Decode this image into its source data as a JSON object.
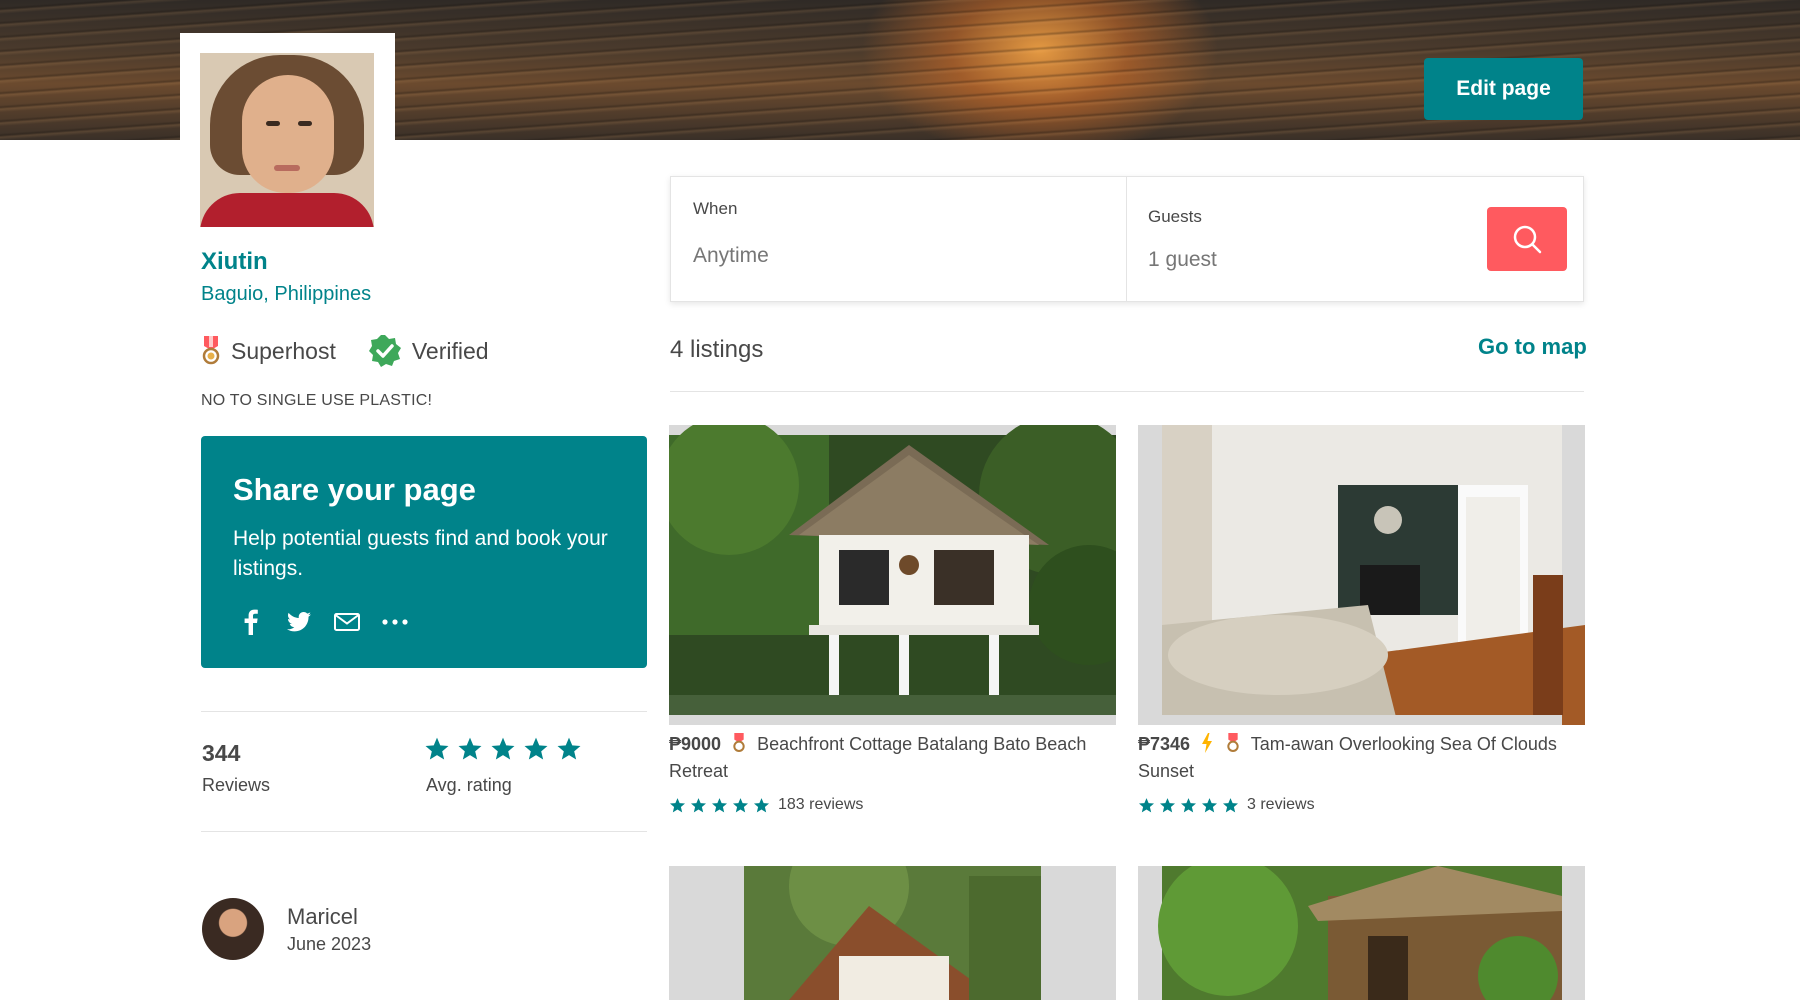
{
  "header": {
    "edit_button_label": "Edit page"
  },
  "profile": {
    "name": "Xiutin",
    "location": "Baguio, Philippines",
    "badges": {
      "superhost": "Superhost",
      "verified": "Verified"
    },
    "bio": "NO TO SINGLE USE PLASTIC!"
  },
  "share_card": {
    "title": "Share your page",
    "text": "Help potential guests find and book your listings.",
    "icons": [
      "facebook-icon",
      "twitter-icon",
      "mail-icon",
      "more-icon"
    ]
  },
  "stats": {
    "reviews_count": "344",
    "reviews_label": "Reviews",
    "avg_rating_label": "Avg. rating",
    "avg_rating_stars": 5
  },
  "review": {
    "reviewer_name": "Maricel",
    "date": "June 2023"
  },
  "search": {
    "when_label": "When",
    "when_value": "Anytime",
    "guests_label": "Guests",
    "guests_value": "1 guest"
  },
  "listings_header": {
    "count_label": "4 listings",
    "map_link": "Go to map"
  },
  "listings": [
    {
      "price": "₱9000",
      "superhost": true,
      "instant_book": false,
      "title": "Beachfront Cottage Batalang Bato Beach Retreat",
      "stars": 5,
      "reviews": "183 reviews"
    },
    {
      "price": "₱7346",
      "superhost": true,
      "instant_book": true,
      "title": "Tam-awan Overlooking Sea Of Clouds Sunset",
      "stars": 5,
      "reviews": "3 reviews"
    }
  ],
  "colors": {
    "brand_teal": "#00838a",
    "search_button": "#ff5a5f",
    "text": "#484848"
  }
}
